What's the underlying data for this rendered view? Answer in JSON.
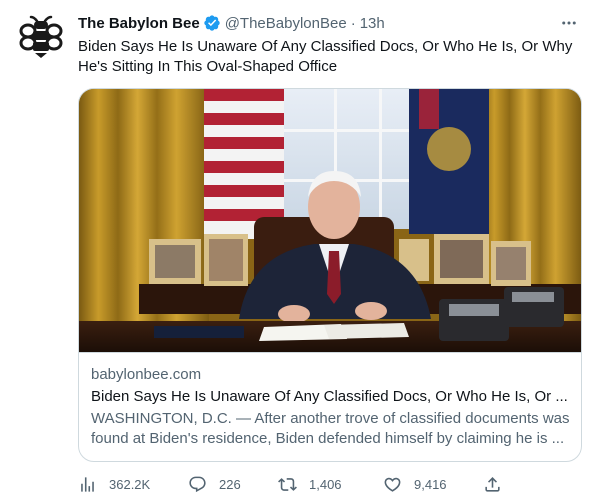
{
  "tweet": {
    "display_name": "The Babylon Bee",
    "handle": "@TheBabylonBee",
    "separator": "·",
    "time": "13h",
    "text": "Biden Says He Is Unaware Of Any Classified Docs, Or Who He Is, Or Why He's Sitting In This Oval-Shaped Office",
    "avatar_icon": "bee-logo-icon",
    "verified_icon": "verified-badge-icon",
    "colors": {
      "verified": "#1d9bf0",
      "text": "#0f1419",
      "muted": "#536471",
      "border": "#cfd9de"
    }
  },
  "card": {
    "image_icon": "article-photo",
    "domain": "babylonbee.com",
    "title": "Biden Says He Is Unaware Of Any Classified Docs, Or Who He Is, Or ...",
    "description": "WASHINGTON, D.C. — After another trove of classified documents was found at Biden's residence, Biden defended himself by claiming he is ..."
  },
  "actions": {
    "views": {
      "icon": "views-icon",
      "count": "362.2K"
    },
    "reply": {
      "icon": "reply-icon",
      "count": "226"
    },
    "retweet": {
      "icon": "retweet-icon",
      "count": "1,406"
    },
    "like": {
      "icon": "like-icon",
      "count": "9,416"
    },
    "share": {
      "icon": "share-icon"
    }
  }
}
